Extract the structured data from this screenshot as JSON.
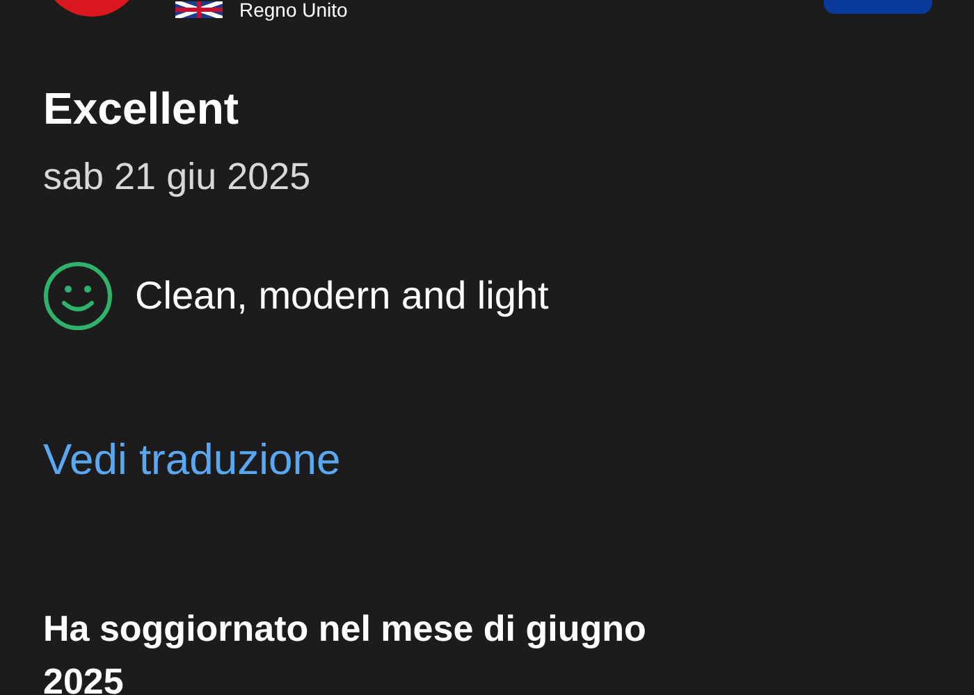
{
  "reviewer": {
    "country": "Regno Unito"
  },
  "review": {
    "title": "Excellent",
    "date": "sab 21 giu 2025",
    "positive": true,
    "text": "Clean, modern and light"
  },
  "translate_link": "Vedi traduzione",
  "stay": "Ha soggiornato nel mese di giugno 2025"
}
